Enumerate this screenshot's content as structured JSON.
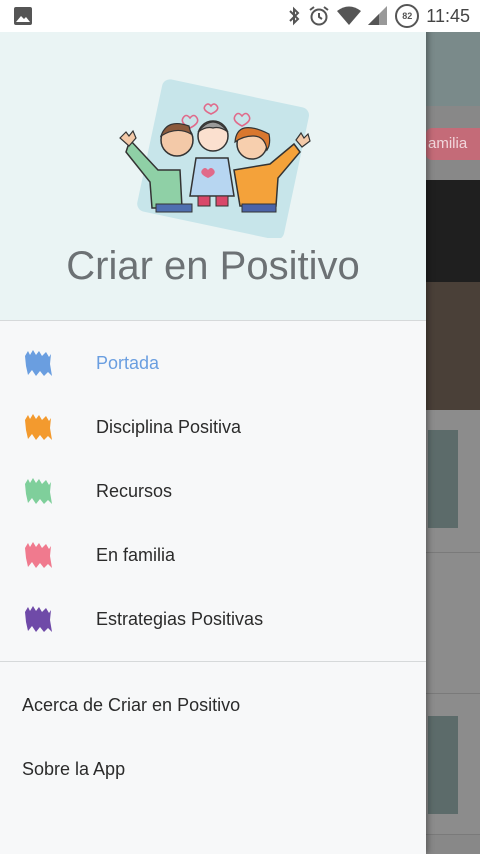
{
  "status_bar": {
    "time": "11:45",
    "battery_level": "82",
    "icons": [
      "image-icon",
      "bluetooth-icon",
      "alarm-icon",
      "wifi-icon",
      "signal-icon",
      "battery-icon"
    ]
  },
  "drawer": {
    "app_title": "Criar en Positivo",
    "menu_items": [
      {
        "label": "Portada",
        "color": "#6a9ee0",
        "active": true
      },
      {
        "label": "Disciplina Positiva",
        "color": "#f39a2e",
        "active": false
      },
      {
        "label": "Recursos",
        "color": "#7fcf9b",
        "active": false
      },
      {
        "label": "En familia",
        "color": "#f07a8e",
        "active": false
      },
      {
        "label": "Estrategias Positivas",
        "color": "#6f4aa8",
        "active": false
      }
    ],
    "secondary_items": [
      {
        "label": "Acerca de Criar en Positivo"
      },
      {
        "label": "Sobre la App"
      }
    ]
  },
  "background": {
    "chip_label": "amilia"
  },
  "colors": {
    "header_bg": "#eaf4f4",
    "drawer_bg": "#f7f8f9",
    "active_text": "#6a9ee0"
  }
}
